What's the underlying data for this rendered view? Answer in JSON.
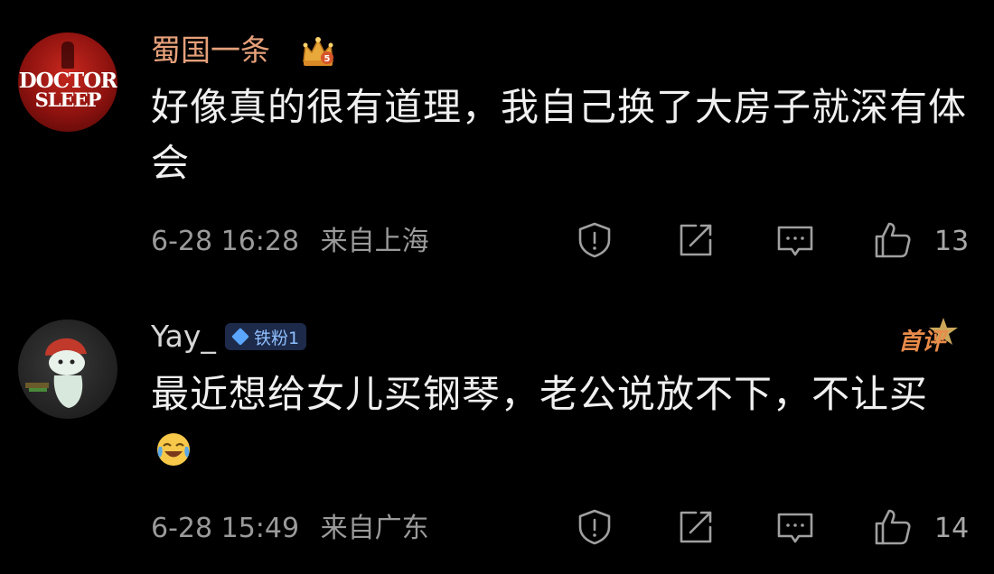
{
  "comments": [
    {
      "username": "蜀国一条",
      "avatar_text_1": "DOCTOR",
      "avatar_text_2": "SLEEP",
      "badge_icon": "crown-icon",
      "body": "好像真的很有道理，我自己换了大房子就深有体会",
      "date": "6-28 16:28",
      "location": "来自上海",
      "likes": "13"
    },
    {
      "username": "Yay_",
      "badge_label": "铁粉1",
      "first_label": "首评",
      "body": "最近想给女儿买钢琴，老公说放不下，不让买",
      "emoji": "crying-laughing-emoji",
      "date": "6-28 15:49",
      "location": "来自广东",
      "likes": "14"
    }
  ],
  "colors": {
    "background": "#000000",
    "vip_username": "#e6a07a",
    "text": "#f0f0f0",
    "meta": "#9a9a9a"
  }
}
